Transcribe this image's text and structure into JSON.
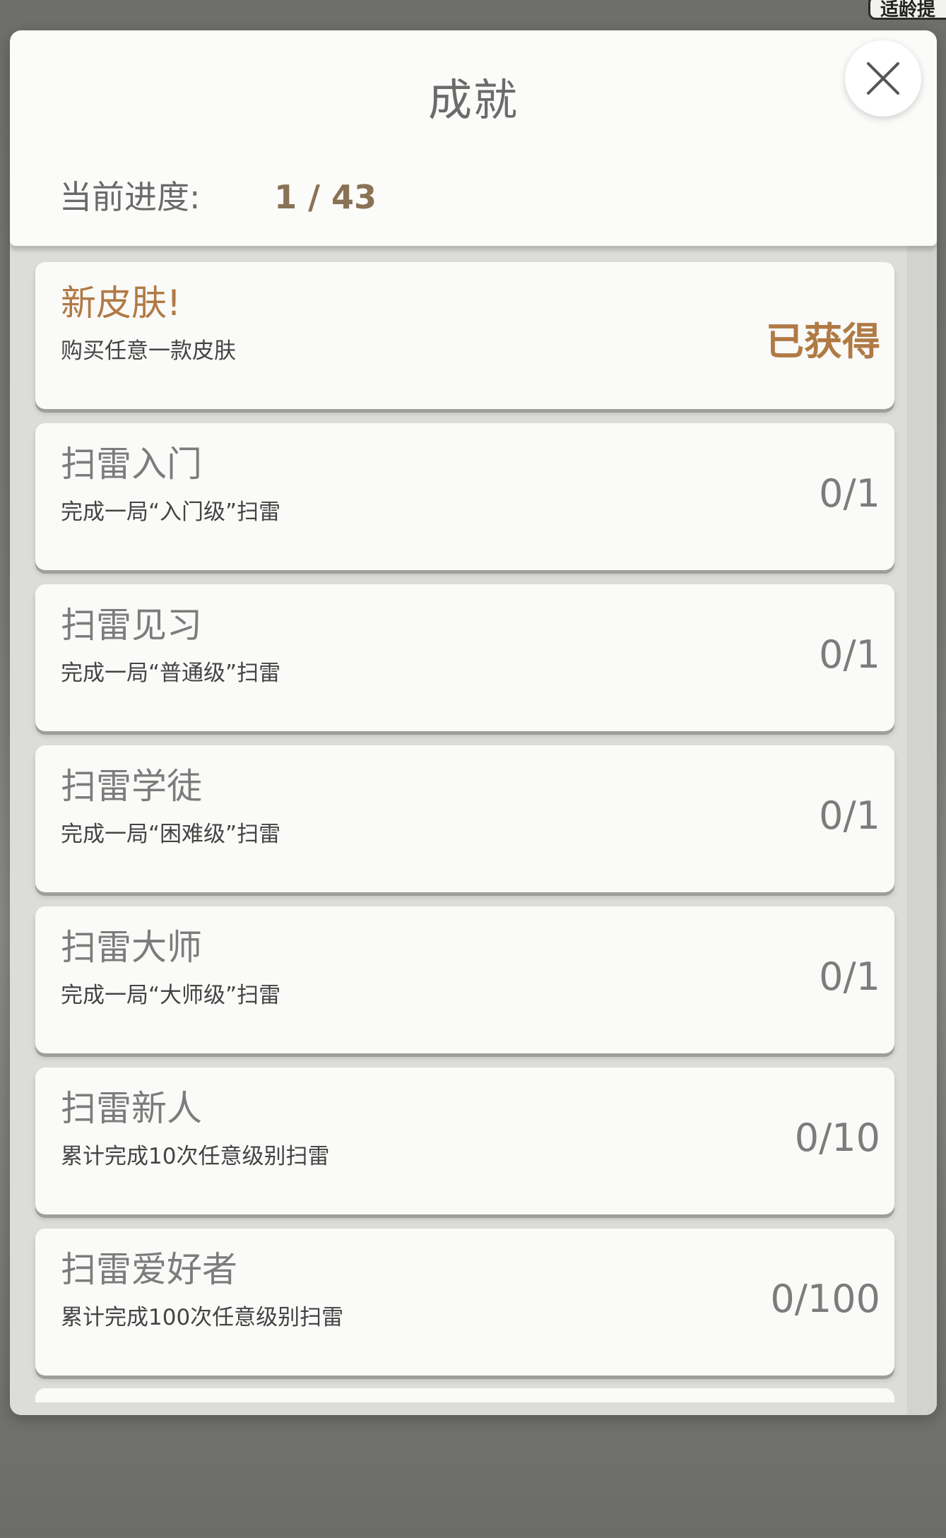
{
  "background": {
    "corner_tag": "适龄提"
  },
  "header": {
    "title": "成就",
    "progress_label": "当前进度:",
    "progress_value": "1 / 43"
  },
  "achievements": [
    {
      "title": "新皮肤!",
      "desc": "购买任意一款皮肤",
      "status": "已获得",
      "earned": true
    },
    {
      "title": "扫雷入门",
      "desc": "完成一局“入门级”扫雷",
      "status": "0/1",
      "earned": false
    },
    {
      "title": "扫雷见习",
      "desc": "完成一局“普通级”扫雷",
      "status": "0/1",
      "earned": false
    },
    {
      "title": "扫雷学徒",
      "desc": "完成一局“困难级”扫雷",
      "status": "0/1",
      "earned": false
    },
    {
      "title": "扫雷大师",
      "desc": "完成一局“大师级”扫雷",
      "status": "0/1",
      "earned": false
    },
    {
      "title": "扫雷新人",
      "desc": "累计完成10次任意级别扫雷",
      "status": "0/10",
      "earned": false
    },
    {
      "title": "扫雷爱好者",
      "desc": "累计完成100次任意级别扫雷",
      "status": "0/100",
      "earned": false
    }
  ],
  "colors": {
    "accent": "#b07a45",
    "muted": "#7c7c7c",
    "progress": "#8a7255"
  },
  "icons": {
    "close": "close-icon"
  }
}
